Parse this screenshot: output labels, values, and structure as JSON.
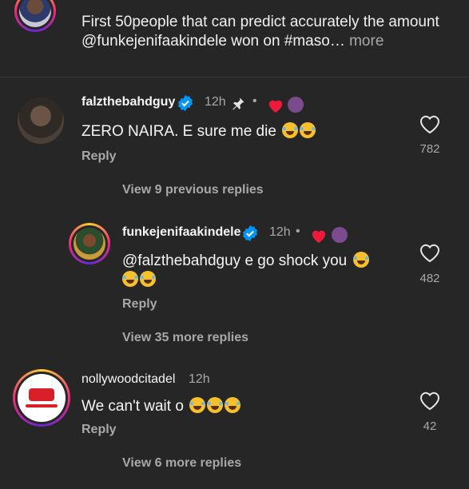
{
  "caption": {
    "text": "First 50people that can predict accurately the amount @funkejenifaakindele won on #maso…",
    "more": " more"
  },
  "comments": [
    {
      "username": "falzthebahdguy",
      "time": "12h",
      "text": "ZERO NAIRA. E sure me die",
      "reply": "Reply",
      "likes": "782",
      "view_replies": "View 9 previous replies"
    },
    {
      "username": "funkejenifaakindele",
      "time": "12h",
      "text": "@falzthebahdguy e go shock you",
      "reply": "Reply",
      "likes": "482",
      "view_replies": "View 35 more replies"
    },
    {
      "username": "nollywoodcitadel",
      "time": "12h",
      "text": "We can't wait o",
      "reply": "Reply",
      "likes": "42",
      "view_replies": "View 6 more replies"
    }
  ],
  "colors": {
    "background": "#262626",
    "verified": "#0095f6",
    "heart_red": "#ed1a3b"
  },
  "icons": [
    "heart-outline-icon",
    "verified-badge-icon",
    "pin-icon",
    "red-heart-icon",
    "emoji-joy-icon"
  ]
}
